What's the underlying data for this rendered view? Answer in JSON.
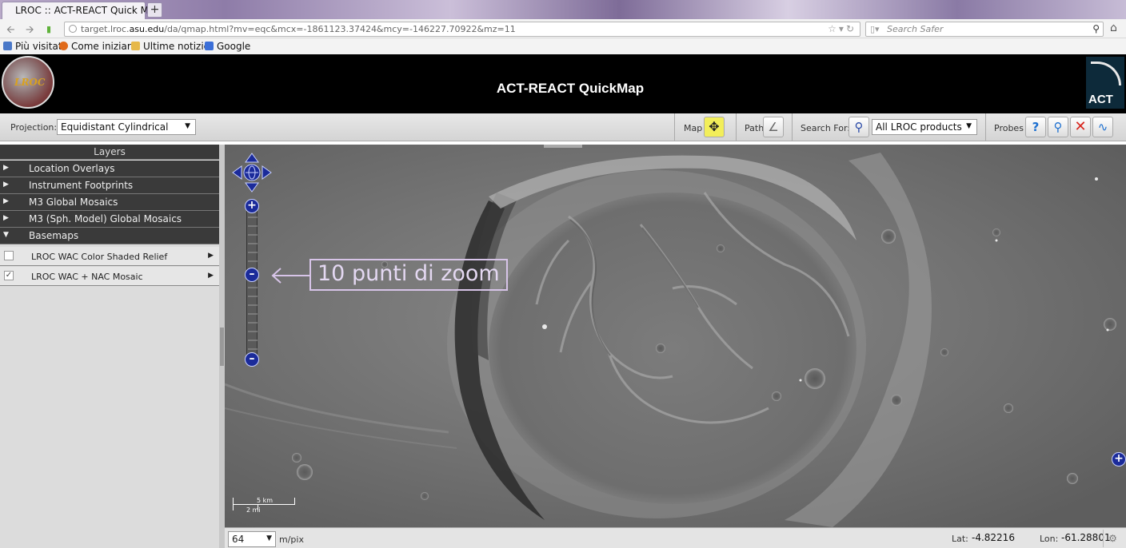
{
  "browser": {
    "tab_title": "LROC :: ACT-REACT Quick Map",
    "new_tab": "+",
    "url_prefix": "target.lroc.",
    "url_host": "asu.edu",
    "url_path": "/da/qmap.html?mv=eqc&mcx=-1861123.37424&mcy=-146227.70922&mz=11",
    "search_placeholder": "Search Safer"
  },
  "bookmarks": [
    {
      "label": "Più visitati",
      "icon": "bookmark-icon",
      "color": "#4a78c8"
    },
    {
      "label": "Come iniziare",
      "icon": "firefox-icon",
      "color": "#e06a1a"
    },
    {
      "label": "Ultime notizie",
      "icon": "rss-folder-icon",
      "color": "#e6b84a"
    },
    {
      "label": "Google",
      "icon": "google-icon",
      "color": "#3b6fd8"
    }
  ],
  "app": {
    "title": "ACT-REACT QuickMap",
    "logo_text": "LROC",
    "act_logo_text": "ACT"
  },
  "toolbar": {
    "projection_label": "Projection:",
    "projection_value": "Equidistant Cylindrical",
    "map_label": "Map",
    "path_label": "Path",
    "search_label": "Search For:",
    "search_value": "All LROC products",
    "probes_label": "Probes"
  },
  "layers": {
    "header": "Layers",
    "groups": [
      {
        "label": "Location Overlays",
        "expanded": false
      },
      {
        "label": "Instrument Footprints",
        "expanded": false
      },
      {
        "label": "M3 Global Mosaics",
        "expanded": false
      },
      {
        "label": "M3 (Sph. Model) Global Mosaics",
        "expanded": false
      },
      {
        "label": "Basemaps",
        "expanded": true
      }
    ],
    "basemaps": [
      {
        "label": "LROC WAC Color Shaded Relief",
        "checked": false
      },
      {
        "label": "LROC WAC + NAC Mosaic",
        "checked": true
      }
    ]
  },
  "map": {
    "annotation": "10 punti di zoom",
    "zoom_level_index": 10,
    "scale_km": "5 km",
    "scale_mi": "2 mi"
  },
  "status": {
    "resolution": "64",
    "resolution_unit": "m/pix",
    "lat_label": "Lat:",
    "lat_value": "-4.82216",
    "lon_label": "Lon:",
    "lon_value": "-61.28801"
  }
}
